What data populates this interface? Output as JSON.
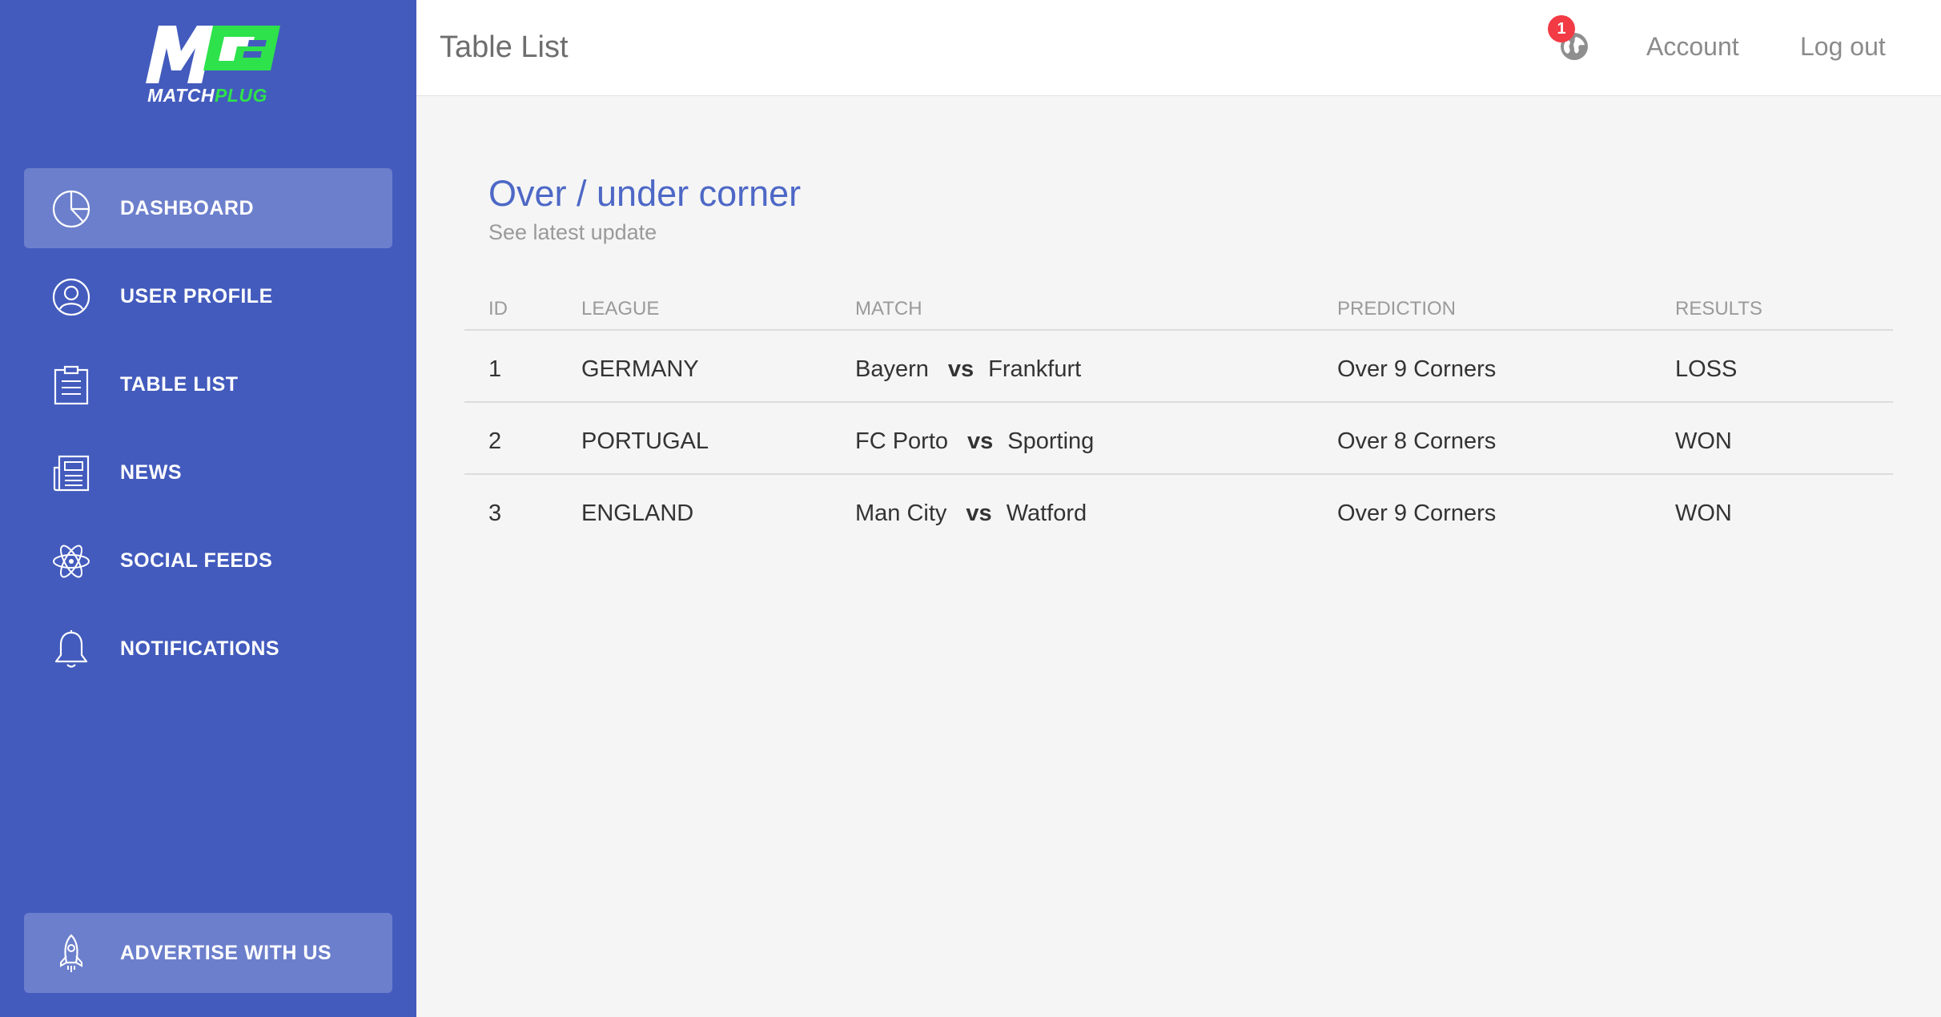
{
  "brand": {
    "logo_prefix": "MATCH",
    "logo_suffix": "PLUG",
    "colors": {
      "sidebar": "#435bbd",
      "accent_green": "#2ee24b",
      "title_blue": "#4d68c6",
      "badge_red": "#f23b45"
    }
  },
  "sidebar": {
    "items": [
      {
        "label": "DASHBOARD",
        "icon": "pie-chart-icon",
        "active": true
      },
      {
        "label": "USER PROFILE",
        "icon": "user-icon",
        "active": false
      },
      {
        "label": "TABLE LIST",
        "icon": "clipboard-icon",
        "active": false
      },
      {
        "label": "NEWS",
        "icon": "newspaper-icon",
        "active": false
      },
      {
        "label": "SOCIAL FEEDS",
        "icon": "atom-icon",
        "active": false
      },
      {
        "label": "NOTIFICATIONS",
        "icon": "bell-icon",
        "active": false
      }
    ],
    "cta": {
      "label": "ADVERTISE WITH US",
      "icon": "rocket-icon"
    }
  },
  "header": {
    "title": "Table List",
    "notification_count": "1",
    "notification_icon": "globe-icon",
    "account_label": "Account",
    "logout_label": "Log out"
  },
  "main": {
    "title": "Over / under corner",
    "subtitle": "See latest update",
    "table": {
      "columns": [
        "ID",
        "LEAGUE",
        "MATCH",
        "PREDICTION",
        "RESULTS"
      ],
      "rows": [
        {
          "id": "1",
          "league": "GERMANY",
          "home": "Bayern",
          "vs": "vs",
          "away": "Frankfurt",
          "prediction": "Over 9 Corners",
          "result": "LOSS"
        },
        {
          "id": "2",
          "league": "PORTUGAL",
          "home": "FC Porto",
          "vs": "vs",
          "away": "Sporting",
          "prediction": "Over 8 Corners",
          "result": "WON"
        },
        {
          "id": "3",
          "league": "ENGLAND",
          "home": "Man City",
          "vs": "vs",
          "away": "Watford",
          "prediction": "Over 9 Corners",
          "result": "WON"
        }
      ]
    }
  }
}
